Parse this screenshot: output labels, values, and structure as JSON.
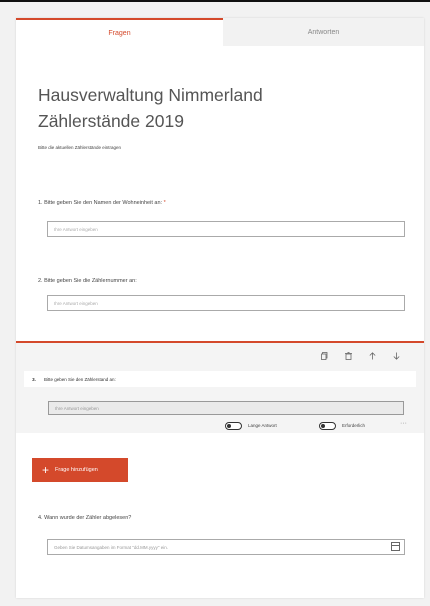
{
  "tabs": {
    "questions": "Fragen",
    "answers": "Antworten"
  },
  "form": {
    "title_line1": "Hausverwaltung Nimmerland",
    "title_line2": "Zählerstände 2019",
    "subtitle": "Bitte die aktuellen Zählerstände eintragen"
  },
  "questions": [
    {
      "label": "1. Bitte geben Sie den Namen der Wohneinheit an:",
      "required_mark": "*",
      "placeholder": "Ihre Antwort eingeben"
    },
    {
      "label": "2. Bitte geben Sie die Zählernummer an:",
      "placeholder": "Ihre Antwort eingeben"
    },
    {
      "number": "3.",
      "label": "Bitte geben Sie den Zählerstand an:",
      "placeholder": "Ihre Antwort eingeben",
      "long_answer_label": "Lange Antwort",
      "required_label": "Erforderlich",
      "more": "···"
    },
    {
      "label": "4. Wann wurde der Zähler abgelesen?",
      "placeholder": "Geben Sie Datumsangaben im Format \"dd.MM.yyyy\" ein."
    }
  ],
  "toolbar_icons": [
    "copy-icon",
    "delete-icon",
    "arrow-up-icon",
    "arrow-down-icon"
  ],
  "add_question": {
    "plus": "+",
    "label": "Frage hinzufügen"
  },
  "colors": {
    "accent": "#d4492b"
  }
}
